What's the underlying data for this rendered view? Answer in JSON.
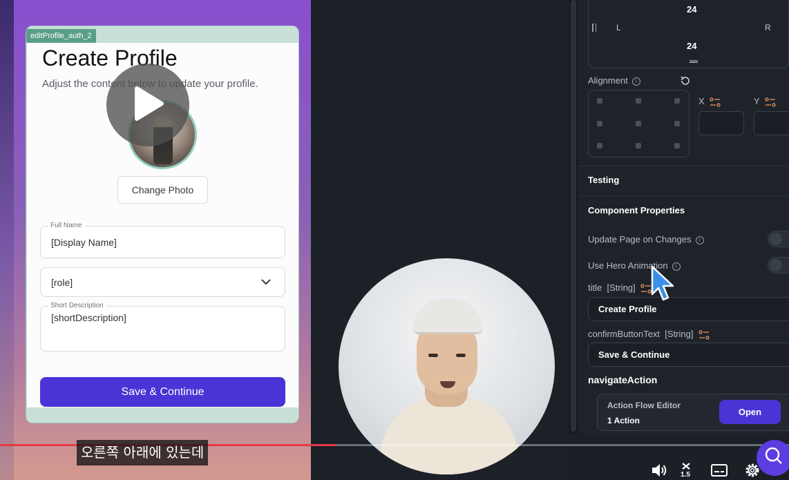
{
  "frame": {
    "label": "editProfile_auth_2"
  },
  "screen": {
    "title": "Create Profile",
    "subtitle": "Adjust the content below to update your profile.",
    "change_photo": "Change Photo",
    "fields": {
      "full_name_label": "Full Name",
      "full_name_value": "[Display Name]",
      "role_value": "[role]",
      "short_desc_label": "Short Description",
      "short_desc_value": "[shortDescription]"
    },
    "save_button": "Save & Continue"
  },
  "panel": {
    "padding": {
      "top": "24",
      "bottom": "24",
      "left": "L",
      "right": "R"
    },
    "alignment_label": "Alignment",
    "x_label": "X",
    "y_label": "Y",
    "testing": "Testing",
    "component_properties": "Component Properties",
    "update_page_on_changes": "Update Page on Changes",
    "use_hero_animation": "Use Hero Animation",
    "title_prop_label": "title",
    "title_prop_type": "[String]",
    "title_prop_value": "Create Profile",
    "confirm_prop_label": "confirmButtonText",
    "confirm_prop_type": "[String]",
    "confirm_prop_value": "Save & Continue",
    "navigate_action": "navigateAction",
    "action_flow_editor": "Action Flow Editor",
    "action_count": "1 Action",
    "open_button": "Open"
  },
  "player": {
    "caption": "오른쪽 아래에 있는데",
    "progress": 0.426,
    "speed": "1.5"
  },
  "colors": {
    "accent": "#4b34d6",
    "progress": "#e63946",
    "frame_green": "#5a9e88"
  }
}
